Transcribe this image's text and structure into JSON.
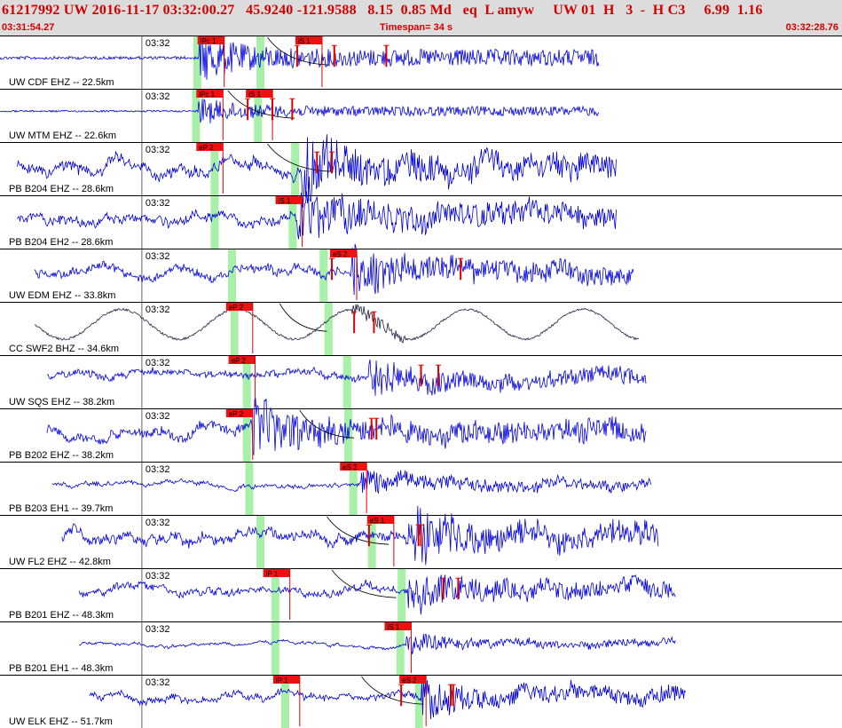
{
  "header": {
    "title": "61217992 UW 2016-11-17 03:32:00.27   45.9240 -121.9588   8.15  0.85 Md   eq  L amyw     UW 01  H   3  -  H C3     6.99  1.16",
    "start_time": "03:31:54.27",
    "timespan": "Timespan=  34 s",
    "end_time": "03:32:28.76"
  },
  "colors": {
    "header_bg": "#dcdcdc",
    "trace": "#0000e0",
    "pick_bg": "#ee1111",
    "pick_text": "#000000",
    "pick_line": "#dd0000",
    "window": "#a8f0a8",
    "travel_curve": "#000000",
    "separator": "#000000",
    "tick_line": "#000000"
  },
  "chart_data": {
    "type": "line",
    "timespan_s": 34,
    "time_tick_label": "03:32",
    "time_tick_s": 5.73,
    "channels": [
      {
        "label": "UW CDF EHZ -- 22.5km",
        "style": "spiky",
        "amp": 0.32,
        "start": 0,
        "end": 24.2,
        "picks": [
          {
            "label": "iPc 1",
            "t": 8.05
          },
          {
            "label": "iS 1",
            "t": 12.0,
            "tick": true
          },
          {
            "label": "",
            "t": 13.5,
            "tick": true
          },
          {
            "label": "",
            "t": 15.6,
            "tick": true
          }
        ],
        "windows": [
          7.95,
          10.5
        ],
        "arrival": 8.05,
        "curve": [
          10.8,
          13.3
        ]
      },
      {
        "label": "UW MTM EHZ -- 22.6km",
        "style": "spiky",
        "amp": 0.18,
        "start": 0,
        "end": 24.2,
        "picks": [
          {
            "label": "iPc 1",
            "t": 8.0
          },
          {
            "label": "iS 1",
            "t": 10.0,
            "tick": true
          },
          {
            "label": "",
            "t": 11.0,
            "tick": true
          },
          {
            "label": "",
            "t": 11.8,
            "tick": true
          }
        ],
        "windows": [
          7.9,
          10.4
        ],
        "arrival": 8.0,
        "curve": [
          9.2,
          11.9
        ]
      },
      {
        "label": "PB B204 EHZ -- 28.6km",
        "style": "noisy",
        "amp": 0.45,
        "start": 0.7,
        "end": 24.9,
        "picks": [
          {
            "label": "eP 2",
            "t": 8.0
          },
          {
            "label": "",
            "t": 12.8,
            "tick": true
          },
          {
            "label": "",
            "t": 13.4,
            "tick": true
          }
        ],
        "windows": [
          8.65,
          11.9
        ],
        "arrival": 12.2,
        "curve": [
          10.8,
          13.4
        ]
      },
      {
        "label": "PB B204 EH2 -- 28.6km",
        "style": "noisy",
        "amp": 0.4,
        "start": 0.7,
        "end": 24.9,
        "picks": [
          {
            "label": "iS 1",
            "t": 11.2
          }
        ],
        "windows": [
          8.65,
          11.8
        ],
        "arrival": 12.0,
        "curve": []
      },
      {
        "label": "UW EDM EHZ -- 33.8km",
        "style": "noisy",
        "amp": 0.36,
        "start": 1.4,
        "end": 25.6,
        "picks": [
          {
            "label": "eS 2",
            "t": 13.4,
            "tick": true
          },
          {
            "label": "",
            "t": 18.6,
            "tick": true
          }
        ],
        "windows": [
          9.35,
          13.05
        ],
        "arrival": 14.1,
        "curve": []
      },
      {
        "label": "CC SWF2 BHZ -- 34.6km",
        "style": "wave",
        "amp": 0.3,
        "start": 1.4,
        "end": 25.8,
        "picks": [
          {
            "label": "eP 2",
            "t": 9.2
          },
          {
            "label": "",
            "t": 14.3,
            "tick": true
          },
          {
            "label": "",
            "t": 15.1,
            "tick": true
          }
        ],
        "windows": [
          9.45,
          13.25
        ],
        "arrival": 14.2,
        "curve": [
          11.3,
          13.2
        ]
      },
      {
        "label": "UW SQS EHZ -- 38.2km",
        "style": "noisy",
        "amp": 0.28,
        "start": 1.9,
        "end": 26.1,
        "picks": [
          {
            "label": "eP 2",
            "t": 9.3
          },
          {
            "label": "",
            "t": 17.0,
            "tick": true
          },
          {
            "label": "",
            "t": 17.7,
            "tick": true
          }
        ],
        "windows": [
          9.95,
          14.0
        ],
        "arrival": 14.9,
        "curve": []
      },
      {
        "label": "PB B202 EHZ -- 38.2km",
        "style": "noisy",
        "amp": 0.4,
        "start": 1.9,
        "end": 26.1,
        "picks": [
          {
            "label": "eP 2",
            "t": 9.2
          },
          {
            "label": "",
            "t": 15.0,
            "tick": true
          },
          {
            "label": "",
            "t": 15.2,
            "tick": true
          }
        ],
        "windows": [
          9.95,
          14.05
        ],
        "arrival": 10.2,
        "curve": [
          12.1,
          14.3
        ]
      },
      {
        "label": "PB B203 EH1 -- 39.7km",
        "style": "quiet",
        "amp": 0.2,
        "start": 2.1,
        "end": 26.3,
        "picks": [
          {
            "label": "eS 2",
            "t": 13.8
          }
        ],
        "windows": [
          10.05,
          14.25
        ],
        "arrival": 14.6,
        "curve": []
      },
      {
        "label": "UW FL2 EHZ -- 42.8km",
        "style": "noisy",
        "amp": 0.42,
        "start": 2.5,
        "end": 26.6,
        "picks": [
          {
            "label": "eS 1",
            "t": 14.9,
            "tick": true
          },
          {
            "label": "",
            "t": 16.9,
            "tick": true
          },
          {
            "label": "",
            "t": 17.0,
            "tick": true
          }
        ],
        "windows": [
          10.5,
          15.0
        ],
        "arrival": 16.5,
        "curve": [
          13.2,
          15.7
        ]
      },
      {
        "label": "PB B201 EHZ -- 48.3km",
        "style": "noisy",
        "amp": 0.3,
        "start": 3.2,
        "end": 27.3,
        "picks": [
          {
            "label": "iP 1",
            "t": 10.7
          },
          {
            "label": "",
            "t": 17.9,
            "tick": true
          },
          {
            "label": "",
            "t": 18.5,
            "tick": true
          }
        ],
        "windows": [
          11.1,
          16.2
        ],
        "arrival": 16.45,
        "curve": [
          13.4,
          16.0
        ]
      },
      {
        "label": "PB B201 EH1 -- 48.3km",
        "style": "quiet",
        "amp": 0.14,
        "start": 3.2,
        "end": 27.3,
        "picks": [
          {
            "label": "iS 1",
            "t": 15.6
          }
        ],
        "windows": [
          11.1,
          16.15
        ],
        "arrival": 16.4,
        "curve": []
      },
      {
        "label": "UW ELK EHZ -- 51.7km",
        "style": "noisy",
        "amp": 0.28,
        "start": 3.6,
        "end": 27.7,
        "picks": [
          {
            "label": "iP 1",
            "t": 11.1
          },
          {
            "label": "eS 2",
            "t": 16.2,
            "tick": true
          },
          {
            "label": "",
            "t": 18.2,
            "tick": true
          },
          {
            "label": "",
            "t": 18.3,
            "tick": true
          }
        ],
        "windows": [
          11.5,
          16.9
        ],
        "arrival": 17.0,
        "curve": [
          14.6,
          17.1
        ]
      }
    ]
  }
}
